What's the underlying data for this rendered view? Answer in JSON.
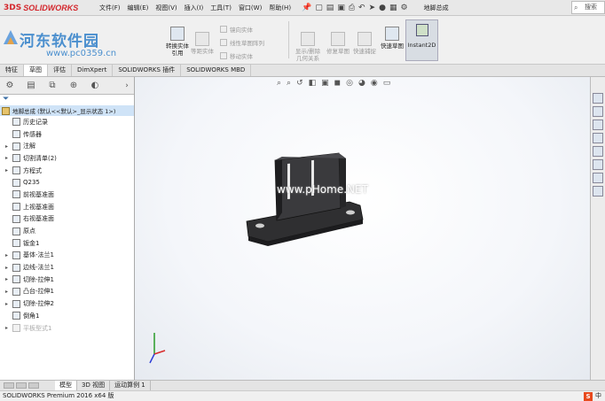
{
  "app": {
    "logo": "SOLIDWORKS",
    "document_title": "地脚总成"
  },
  "menu": [
    "文件(F)",
    "编辑(E)",
    "视图(V)",
    "插入(I)",
    "工具(T)",
    "窗口(W)",
    "帮助(H)"
  ],
  "search": {
    "placeholder": "搜索"
  },
  "watermark": {
    "text": "河东软件园",
    "url": "www.pc0359.cn"
  },
  "commands": {
    "ref_rebuild": "转换实体引用",
    "equal_dist": "等距实体",
    "mirror": "镜向实体",
    "linear_pattern": "线性草图阵列",
    "move": "移动实体",
    "show_relations": "显示/删除几何关系",
    "repair": "修复草图",
    "quick_snap": "快速捕捉",
    "rapid_sketch": "快速草图",
    "instant2d": "Instant2D"
  },
  "tabs": [
    "特征",
    "草图",
    "评估",
    "DimXpert",
    "SOLIDWORKS 插件",
    "SOLIDWORKS MBD"
  ],
  "active_tab": "草图",
  "tree": {
    "root": "地脚总成 (默认<<默认>_显示状态 1>)",
    "items": [
      {
        "label": "历史记录",
        "icon": "history-icon",
        "exp": "",
        "dim": false
      },
      {
        "label": "传感器",
        "icon": "sensor-icon",
        "exp": "",
        "dim": false
      },
      {
        "label": "注解",
        "icon": "annotation-icon",
        "exp": "▸",
        "dim": false
      },
      {
        "label": "切割清单(2)",
        "icon": "cutlist-icon",
        "exp": "▸",
        "dim": false
      },
      {
        "label": "方程式",
        "icon": "equation-icon",
        "exp": "▸",
        "dim": false
      },
      {
        "label": "Q235",
        "icon": "material-icon",
        "exp": "",
        "dim": false
      },
      {
        "label": "前视基准面",
        "icon": "plane-icon",
        "exp": "",
        "dim": false
      },
      {
        "label": "上视基准面",
        "icon": "plane-icon",
        "exp": "",
        "dim": false
      },
      {
        "label": "右视基准面",
        "icon": "plane-icon",
        "exp": "",
        "dim": false
      },
      {
        "label": "原点",
        "icon": "origin-icon",
        "exp": "",
        "dim": false
      },
      {
        "label": "钣金1",
        "icon": "sheetmetal-icon",
        "exp": "",
        "dim": false
      },
      {
        "label": "基体-法兰1",
        "icon": "base-flange-icon",
        "exp": "▸",
        "dim": false
      },
      {
        "label": "边线-法兰1",
        "icon": "edge-flange-icon",
        "exp": "▸",
        "dim": false
      },
      {
        "label": "切除-拉伸1",
        "icon": "cut-extrude-icon",
        "exp": "▸",
        "dim": false
      },
      {
        "label": "凸台-拉伸1",
        "icon": "boss-extrude-icon",
        "exp": "▸",
        "dim": false
      },
      {
        "label": "切除-拉伸2",
        "icon": "cut-extrude-icon",
        "exp": "▸",
        "dim": false
      },
      {
        "label": "倒角1",
        "icon": "chamfer-icon",
        "exp": "",
        "dim": false
      },
      {
        "label": "平板型式1",
        "icon": "flat-pattern-icon",
        "exp": "▸",
        "dim": true
      }
    ]
  },
  "viewport_watermark": "www.pHome.NET",
  "bottom_tabs": [
    "模型",
    "3D 视图",
    "运动算例 1"
  ],
  "active_bottom_tab": "模型",
  "status": {
    "text": "SOLIDWORKS Premium 2016 x64 版",
    "ime": "中"
  }
}
